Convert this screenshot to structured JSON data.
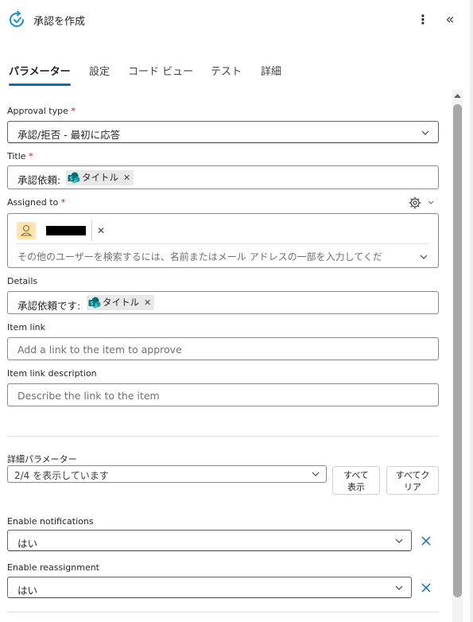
{
  "header": {
    "title": "承認を作成",
    "more_label": "⋮",
    "collapse_label": "«"
  },
  "tabs": [
    {
      "label": "パラメーター",
      "active": true
    },
    {
      "label": "設定",
      "active": false
    },
    {
      "label": "コード ビュー",
      "active": false
    },
    {
      "label": "テスト",
      "active": false
    },
    {
      "label": "詳細",
      "active": false
    }
  ],
  "form": {
    "approval_type": {
      "label": "Approval type",
      "required_mark": "*",
      "value": "承認/拒否 - 最初に応答"
    },
    "title": {
      "label": "Title",
      "required_mark": "*",
      "prefix": "承認依頼:",
      "token": "タイトル",
      "token_remove": "✕"
    },
    "assigned_to": {
      "label": "Assigned to",
      "required_mark": "*",
      "user_remove": "✕",
      "placeholder": "その他のユーザーを検索するには、名前またはメール アドレスの一部を入力してくだ"
    },
    "details": {
      "label": "Details",
      "prefix": "承認依頼です:",
      "token": "タイトル",
      "token_remove": "✕"
    },
    "item_link": {
      "label": "Item link",
      "placeholder": "Add a link to the item to approve"
    },
    "item_link_description": {
      "label": "Item link description",
      "placeholder": "Describe the link to the item"
    }
  },
  "advanced": {
    "label": "詳細パラメーター",
    "select_value": "2/4 を表示しています",
    "show_all_line1": "すべて",
    "show_all_line2": "表示",
    "clear_all_line1": "すべてク",
    "clear_all_line2": "リア"
  },
  "enable_notifications": {
    "label": "Enable notifications",
    "value": "はい",
    "remove": "✕"
  },
  "enable_reassignment": {
    "label": "Enable reassignment",
    "value": "はい",
    "remove": "✕"
  },
  "colors": {
    "accent": "#0f6cbd",
    "required": "#c50f1f",
    "user_avatar_bg": "#fce3b0"
  }
}
